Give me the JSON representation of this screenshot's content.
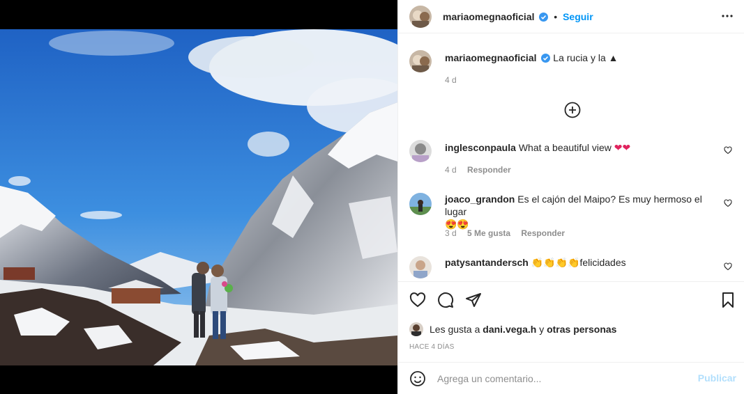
{
  "post": {
    "author": "mariaomegnaoficial",
    "follow_dot": "•",
    "follow_label": "Seguir",
    "caption": "La rucia y la",
    "caption_emoji": "▲",
    "caption_age": "4 d"
  },
  "comments": [
    {
      "user": "inglesconpaula",
      "text": "What a beautiful view",
      "emoji": "❤❤",
      "age": "4 d",
      "reply": "Responder",
      "likes": ""
    },
    {
      "user": "joaco_grandon",
      "text": "Es el cajón del Maipo? Es muy hermoso el lugar",
      "emoji": "😍😍",
      "age": "3 d",
      "likes": "5 Me gusta",
      "reply": "Responder"
    },
    {
      "user": "patysantandersch",
      "text": "felicidades",
      "emoji": "👏👏👏👏"
    }
  ],
  "likes": {
    "prefix": "Les gusta a",
    "user": "dani.vega.h",
    "connector": "y",
    "others": "otras personas"
  },
  "timestamp": "HACE 4 DÍAS",
  "add_comment": {
    "placeholder": "Agrega un comentario...",
    "publish": "Publicar"
  },
  "colors": {
    "accent": "#0095f6",
    "publish_disabled": "#b2dffc",
    "verified": "#3897f0",
    "secondary_text": "#8e8e8e"
  },
  "icons": [
    "more-options-icon",
    "verified-badge-icon",
    "add-circle-icon",
    "heart-icon",
    "comment-icon",
    "share-icon",
    "bookmark-icon",
    "emoji-icon"
  ]
}
